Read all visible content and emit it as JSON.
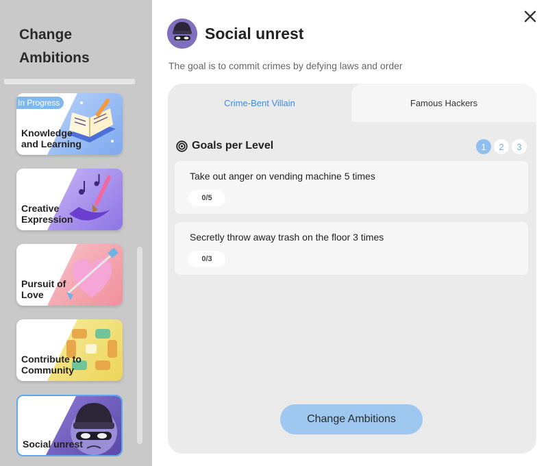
{
  "sidebar": {
    "title": "Change Ambitions",
    "cards": [
      {
        "label": "Knowledge and Learning",
        "badge": "In Progress",
        "icon": "book-icon",
        "color": "#8fb6f0"
      },
      {
        "label": "Creative Expression",
        "icon": "paintbrush-music-icon",
        "color": "#a88be8"
      },
      {
        "label": "Pursuit of Love",
        "icon": "heart-arrow-icon",
        "color": "#f4a3ad"
      },
      {
        "label": "Contribute to Community",
        "icon": "linked-hands-icon",
        "color": "#f3e27a"
      },
      {
        "label": "Social unrest",
        "icon": "masked-villain-icon",
        "color": "#7a66c4",
        "selected": true
      }
    ]
  },
  "main": {
    "title": "Social unrest",
    "description": "The goal is to commit crimes by defying laws and order",
    "tabs": [
      {
        "label": "Crime-Bent Villain",
        "active": true
      },
      {
        "label": "Famous Hackers",
        "active": false
      }
    ],
    "goals_heading": "Goals per Level",
    "levels": [
      "1",
      "2",
      "3"
    ],
    "active_level": "1",
    "goals": [
      {
        "text": "Take out anger on vending machine 5 times",
        "progress": "0/5"
      },
      {
        "text": "Secretly throw away trash on the floor 3 times",
        "progress": "0/3"
      }
    ],
    "change_button": "Change Ambitions"
  },
  "colors": {
    "accent": "#3d8ce4",
    "button": "#9ec8f0",
    "sidebar": "#c9c9c9"
  }
}
